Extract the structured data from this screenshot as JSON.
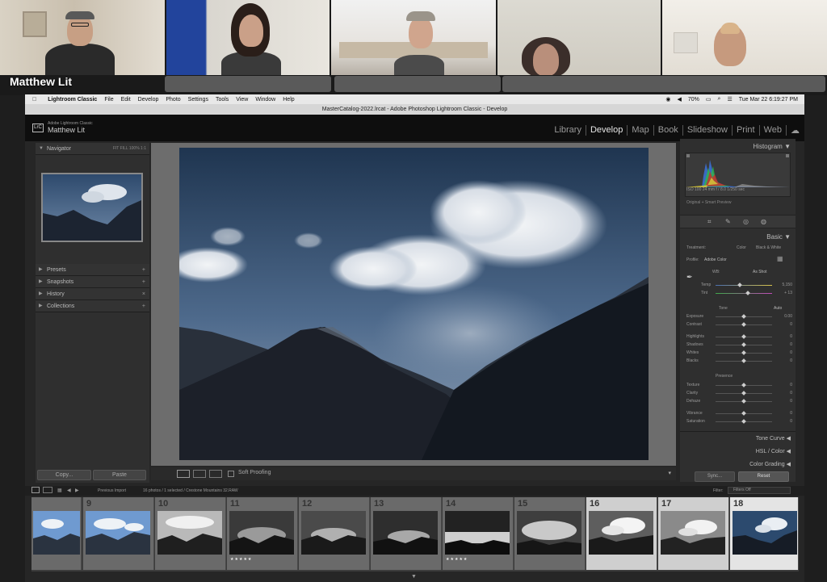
{
  "meeting": {
    "active_speaker": "Matthew Lit"
  },
  "mac_menu": {
    "app_name": "Lightroom Classic",
    "items": [
      "File",
      "Edit",
      "Develop",
      "Photo",
      "Settings",
      "Tools",
      "View",
      "Window",
      "Help"
    ],
    "battery": "70%",
    "clock": "Tue Mar 22  6:19:27 PM"
  },
  "window": {
    "title": "MasterCatalog-2022.lrcat - Adobe Photoshop Lightroom Classic - Develop"
  },
  "lightroom": {
    "brand": "Adobe Lightroom Classic",
    "logo": "LrC",
    "user": "Matthew Lit",
    "modules": [
      {
        "label": "Library",
        "active": false
      },
      {
        "label": "Develop",
        "active": true
      },
      {
        "label": "Map",
        "active": false
      },
      {
        "label": "Book",
        "active": false
      },
      {
        "label": "Slideshow",
        "active": false
      },
      {
        "label": "Print",
        "active": false
      },
      {
        "label": "Web",
        "active": false
      }
    ]
  },
  "left_panel": {
    "navigator": "Navigator",
    "nav_modes": "FIT  FILL  100%  1:1",
    "sections": [
      "Presets",
      "Snapshots",
      "History",
      "Collections"
    ],
    "copy": "Copy...",
    "paste": "Paste"
  },
  "toolbar": {
    "soft_proofing": "Soft Proofing"
  },
  "right_panel": {
    "histogram": "Histogram",
    "histo_info": "ISO 100    24 mm    f / 8.0    1/250 sec",
    "original_preview": "Original + Smart Preview",
    "basic": "Basic",
    "treatment_label": "Treatment:",
    "color": "Color",
    "bw": "Black & White",
    "profile_label": "Profile:",
    "profile_value": "Adobe Color",
    "wb_label": "WB:",
    "wb_value": "As Shot",
    "temp": {
      "label": "Temp",
      "value": "5,150"
    },
    "tint": {
      "label": "Tint",
      "value": "+ 13"
    },
    "tone_label": "Tone",
    "auto_label": "Auto",
    "tone_sliders": [
      {
        "label": "Exposure",
        "value": "0.00"
      },
      {
        "label": "Contrast",
        "value": "0"
      },
      {
        "label": "Highlights",
        "value": "0"
      },
      {
        "label": "Shadows",
        "value": "0"
      },
      {
        "label": "Whites",
        "value": "0"
      },
      {
        "label": "Blacks",
        "value": "0"
      }
    ],
    "presence_label": "Presence",
    "presence_sliders": [
      {
        "label": "Texture",
        "value": "0"
      },
      {
        "label": "Clarity",
        "value": "0"
      },
      {
        "label": "Dehaze",
        "value": "0"
      },
      {
        "label": "Vibrance",
        "value": "0"
      },
      {
        "label": "Saturation",
        "value": "0"
      }
    ],
    "sections": [
      "Tone Curve",
      "HSL / Color",
      "Color Grading"
    ],
    "sync": "Sync...",
    "reset": "Reset"
  },
  "filmstrip": {
    "source": "Previous Import",
    "info": "16 photos / 1 selected / Crestone Mountains 32.RAW",
    "filter_label": "Filter:",
    "filter_value": "Filters Off",
    "numbers": [
      "9",
      "10",
      "11",
      "12",
      "13",
      "14",
      "15",
      "16",
      "17",
      "18"
    ],
    "stars": [
      "",
      "",
      "★★★★★",
      "",
      "",
      "★★★★★",
      "",
      "",
      "",
      ""
    ]
  }
}
